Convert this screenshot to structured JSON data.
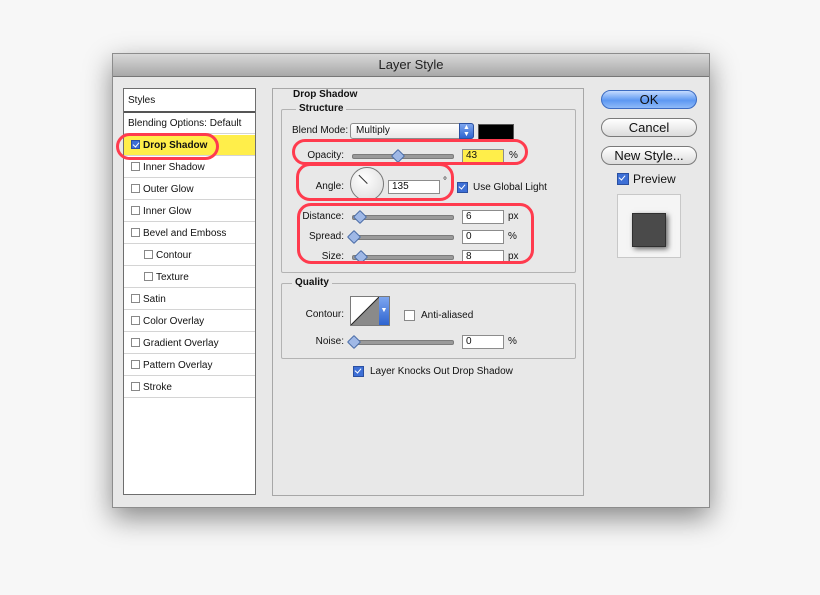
{
  "window": {
    "title": "Layer Style"
  },
  "styles_list": {
    "header": "Styles",
    "blending_options": "Blending Options: Default",
    "items": [
      {
        "label": "Drop Shadow",
        "checked": true,
        "selected": true
      },
      {
        "label": "Inner Shadow",
        "checked": false
      },
      {
        "label": "Outer Glow",
        "checked": false
      },
      {
        "label": "Inner Glow",
        "checked": false
      },
      {
        "label": "Bevel and Emboss",
        "checked": false
      },
      {
        "label": "Contour",
        "checked": false
      },
      {
        "label": "Texture",
        "checked": false
      },
      {
        "label": "Satin",
        "checked": false
      },
      {
        "label": "Color Overlay",
        "checked": false
      },
      {
        "label": "Gradient Overlay",
        "checked": false
      },
      {
        "label": "Pattern Overlay",
        "checked": false
      },
      {
        "label": "Stroke",
        "checked": false
      }
    ]
  },
  "drop_shadow": {
    "section_title": "Drop Shadow",
    "structure": {
      "title": "Structure",
      "blend_mode_label": "Blend Mode:",
      "blend_mode_value": "Multiply",
      "shadow_color": "#000000",
      "opacity_label": "Opacity:",
      "opacity_value": "43",
      "opacity_unit": "%",
      "angle_label": "Angle:",
      "angle_value": "135",
      "angle_unit": "°",
      "use_global_light_label": "Use Global Light",
      "use_global_light_checked": true,
      "distance_label": "Distance:",
      "distance_value": "6",
      "distance_unit": "px",
      "spread_label": "Spread:",
      "spread_value": "0",
      "spread_unit": "%",
      "size_label": "Size:",
      "size_value": "8",
      "size_unit": "px"
    },
    "quality": {
      "title": "Quality",
      "contour_label": "Contour:",
      "anti_aliased_label": "Anti-aliased",
      "anti_aliased_checked": false,
      "noise_label": "Noise:",
      "noise_value": "0",
      "noise_unit": "%"
    },
    "layer_knocks_out_label": "Layer Knocks Out Drop Shadow",
    "layer_knocks_out_checked": true
  },
  "buttons": {
    "ok": "OK",
    "cancel": "Cancel",
    "new_style": "New Style..."
  },
  "preview": {
    "label": "Preview",
    "checked": true
  },
  "colors": {
    "highlight": "#ffee4a",
    "annotation": "#ff3b4e",
    "accent": "#3d6fd6"
  }
}
